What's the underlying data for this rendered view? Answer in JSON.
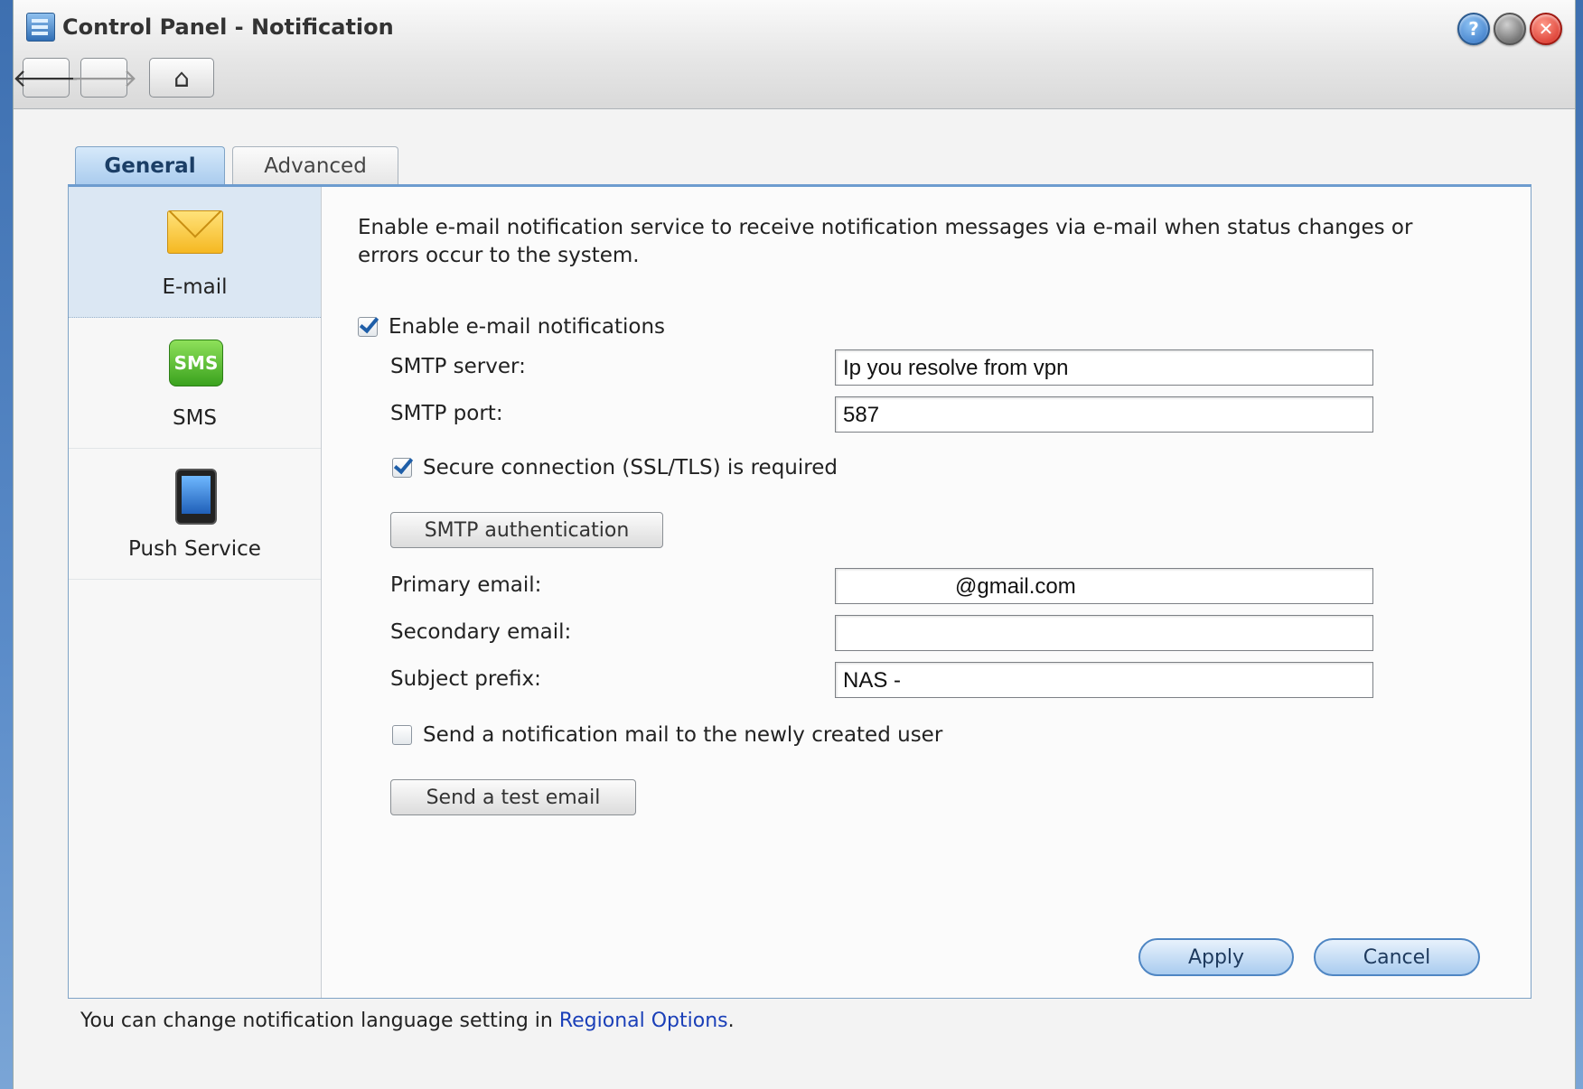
{
  "window": {
    "title": "Control Panel - Notification"
  },
  "toolbar": {
    "back_icon": "arrow-left-icon",
    "forward_icon": "arrow-right-icon",
    "home_icon": "home-icon",
    "help_icon": "help-icon",
    "minimize_icon": "minimize-icon",
    "close_icon": "close-icon",
    "back_glyph": "🡐",
    "forward_glyph": "🡒",
    "home_glyph": "⌂",
    "help_glyph": "?"
  },
  "tabs": [
    {
      "label": "General",
      "active": true
    },
    {
      "label": "Advanced",
      "active": false
    }
  ],
  "sidebar": {
    "items": [
      {
        "label": "E-mail",
        "icon": "envelope-icon",
        "active": true
      },
      {
        "label": "SMS",
        "icon": "sms-icon",
        "active": false,
        "badge": "SMS"
      },
      {
        "label": "Push Service",
        "icon": "mobile-phone-icon",
        "active": false
      }
    ]
  },
  "email": {
    "description": "Enable e-mail notification service to receive notification messages via e-mail when status changes or errors occur to the system.",
    "enable_label": "Enable e-mail notifications",
    "enable_checked": true,
    "smtp_server_label": "SMTP server:",
    "smtp_server_value": "Ip you resolve from vpn",
    "smtp_port_label": "SMTP port:",
    "smtp_port_value": "587",
    "ssl_label": "Secure connection (SSL/TLS) is required",
    "ssl_checked": true,
    "smtp_auth_button": "SMTP authentication",
    "primary_email_label": "Primary email:",
    "primary_email_value": "@gmail.com",
    "secondary_email_label": "Secondary email:",
    "secondary_email_value": "",
    "subject_prefix_label": "Subject prefix:",
    "subject_prefix_value": "NAS -",
    "notify_new_user_label": "Send a notification mail to the newly created user",
    "notify_new_user_checked": false,
    "test_email_button": "Send a test email"
  },
  "actions": {
    "apply": "Apply",
    "cancel": "Cancel"
  },
  "footer": {
    "text": "You can change notification language setting in",
    "link": "Regional Options",
    "end": "."
  },
  "colors": {
    "accent": "#4f86c3",
    "link": "#1a3fb8",
    "active_tab": "#a9cbee"
  }
}
